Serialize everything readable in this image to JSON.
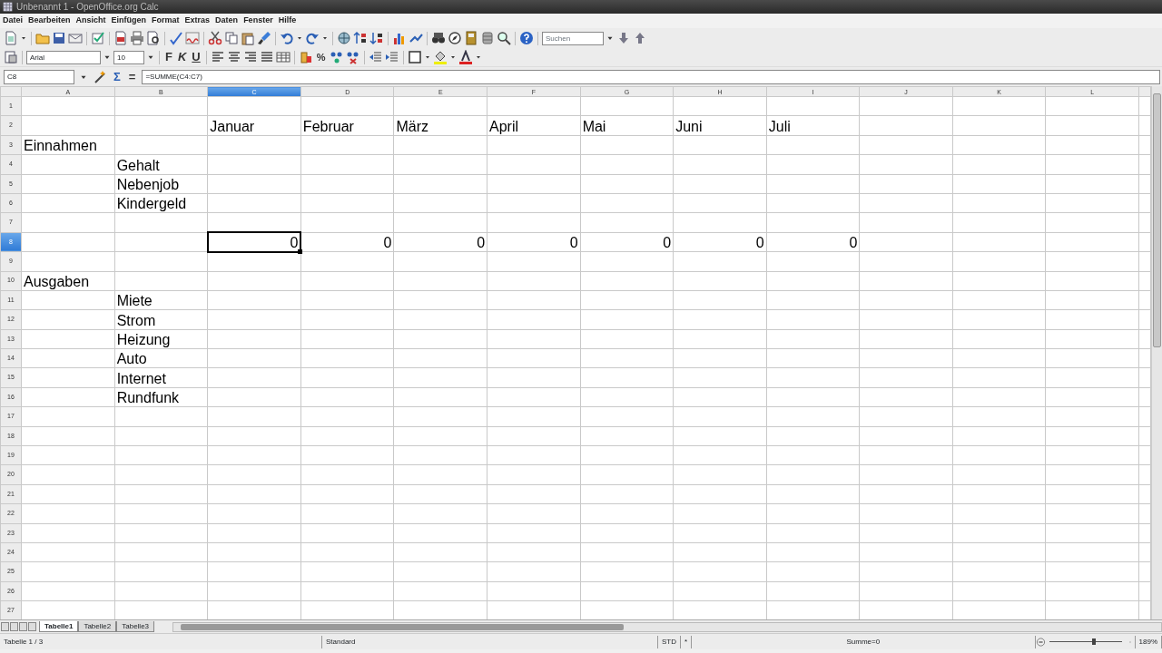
{
  "window": {
    "title": "Unbenannt 1 - OpenOffice.org Calc"
  },
  "menu": [
    "Datei",
    "Bearbeiten",
    "Ansicht",
    "Einfügen",
    "Format",
    "Extras",
    "Daten",
    "Fenster",
    "Hilfe"
  ],
  "toolbar": {
    "search_placeholder": "Suchen"
  },
  "format_toolbar": {
    "font": "Arial",
    "size": "10",
    "bold": "F",
    "italic": "K",
    "underline": "U",
    "percent": "%"
  },
  "formula_bar": {
    "cell_ref": "C8",
    "sum": "Σ",
    "equals": "=",
    "formula": "=SUMME(C4:C7)"
  },
  "columns": [
    {
      "label": "A",
      "selected": false
    },
    {
      "label": "B",
      "selected": false
    },
    {
      "label": "C",
      "selected": true
    },
    {
      "label": "D",
      "selected": false
    },
    {
      "label": "E",
      "selected": false
    },
    {
      "label": "F",
      "selected": false
    },
    {
      "label": "G",
      "selected": false
    },
    {
      "label": "H",
      "selected": false
    },
    {
      "label": "I",
      "selected": false
    },
    {
      "label": "J",
      "selected": false
    },
    {
      "label": "K",
      "selected": false
    },
    {
      "label": "L",
      "selected": false
    }
  ],
  "rows": [
    {
      "label": "1",
      "selected": false
    },
    {
      "label": "2",
      "selected": false,
      "cells": {
        "C": {
          "text": "Januar",
          "kind": "text",
          "selected": false
        },
        "D": {
          "text": "Februar",
          "kind": "text",
          "selected": false
        },
        "E": {
          "text": "März",
          "kind": "text",
          "selected": false
        },
        "F": {
          "text": "April",
          "kind": "text",
          "selected": false
        },
        "G": {
          "text": "Mai",
          "kind": "text",
          "selected": false
        },
        "H": {
          "text": "Juni",
          "kind": "text",
          "selected": false
        },
        "I": {
          "text": "Juli",
          "kind": "text",
          "selected": false
        }
      }
    },
    {
      "label": "3",
      "selected": false,
      "cells": {
        "A": {
          "text": "Einnahmen",
          "kind": "text",
          "selected": false
        }
      }
    },
    {
      "label": "4",
      "selected": false,
      "cells": {
        "B": {
          "text": "Gehalt",
          "kind": "text",
          "selected": false
        }
      }
    },
    {
      "label": "5",
      "selected": false,
      "cells": {
        "B": {
          "text": "Nebenjob",
          "kind": "text",
          "selected": false
        }
      }
    },
    {
      "label": "6",
      "selected": false,
      "cells": {
        "B": {
          "text": "Kindergeld",
          "kind": "text",
          "selected": false
        }
      }
    },
    {
      "label": "7",
      "selected": false
    },
    {
      "label": "8",
      "selected": true,
      "cells": {
        "C": {
          "text": "0",
          "kind": "number",
          "selected": true
        },
        "D": {
          "text": "0",
          "kind": "number",
          "selected": false
        },
        "E": {
          "text": "0",
          "kind": "number",
          "selected": false
        },
        "F": {
          "text": "0",
          "kind": "number",
          "selected": false
        },
        "G": {
          "text": "0",
          "kind": "number",
          "selected": false
        },
        "H": {
          "text": "0",
          "kind": "number",
          "selected": false
        },
        "I": {
          "text": "0",
          "kind": "number",
          "selected": false
        }
      }
    },
    {
      "label": "9",
      "selected": false
    },
    {
      "label": "10",
      "selected": false,
      "cells": {
        "A": {
          "text": "Ausgaben",
          "kind": "text",
          "selected": false
        }
      }
    },
    {
      "label": "11",
      "selected": false,
      "cells": {
        "B": {
          "text": "Miete",
          "kind": "text",
          "selected": false
        }
      }
    },
    {
      "label": "12",
      "selected": false,
      "cells": {
        "B": {
          "text": "Strom",
          "kind": "text",
          "selected": false
        }
      }
    },
    {
      "label": "13",
      "selected": false,
      "cells": {
        "B": {
          "text": "Heizung",
          "kind": "text",
          "selected": false
        }
      }
    },
    {
      "label": "14",
      "selected": false,
      "cells": {
        "B": {
          "text": "Auto",
          "kind": "text",
          "selected": false
        }
      }
    },
    {
      "label": "15",
      "selected": false,
      "cells": {
        "B": {
          "text": "Internet",
          "kind": "text",
          "selected": false
        }
      }
    },
    {
      "label": "16",
      "selected": false,
      "cells": {
        "B": {
          "text": "Rundfunk",
          "kind": "text",
          "selected": false
        }
      }
    },
    {
      "label": "17",
      "selected": false
    },
    {
      "label": "18",
      "selected": false
    },
    {
      "label": "19",
      "selected": false
    },
    {
      "label": "20",
      "selected": false
    },
    {
      "label": "21",
      "selected": false
    },
    {
      "label": "22",
      "selected": false
    },
    {
      "label": "23",
      "selected": false
    },
    {
      "label": "24",
      "selected": false
    },
    {
      "label": "25",
      "selected": false
    },
    {
      "label": "26",
      "selected": false
    },
    {
      "label": "27",
      "selected": false
    }
  ],
  "sheet_tabs": [
    {
      "label": "Tabelle1",
      "selected": true
    },
    {
      "label": "Tabelle2",
      "selected": false
    },
    {
      "label": "Tabelle3",
      "selected": false
    }
  ],
  "status_bar": {
    "sheet": "Tabelle 1 / 3",
    "style": "Standard",
    "mode": "STD",
    "modified": "*",
    "sum": "Summe=0",
    "zoom": {
      "level": 0.62,
      "reading": "189%"
    }
  }
}
